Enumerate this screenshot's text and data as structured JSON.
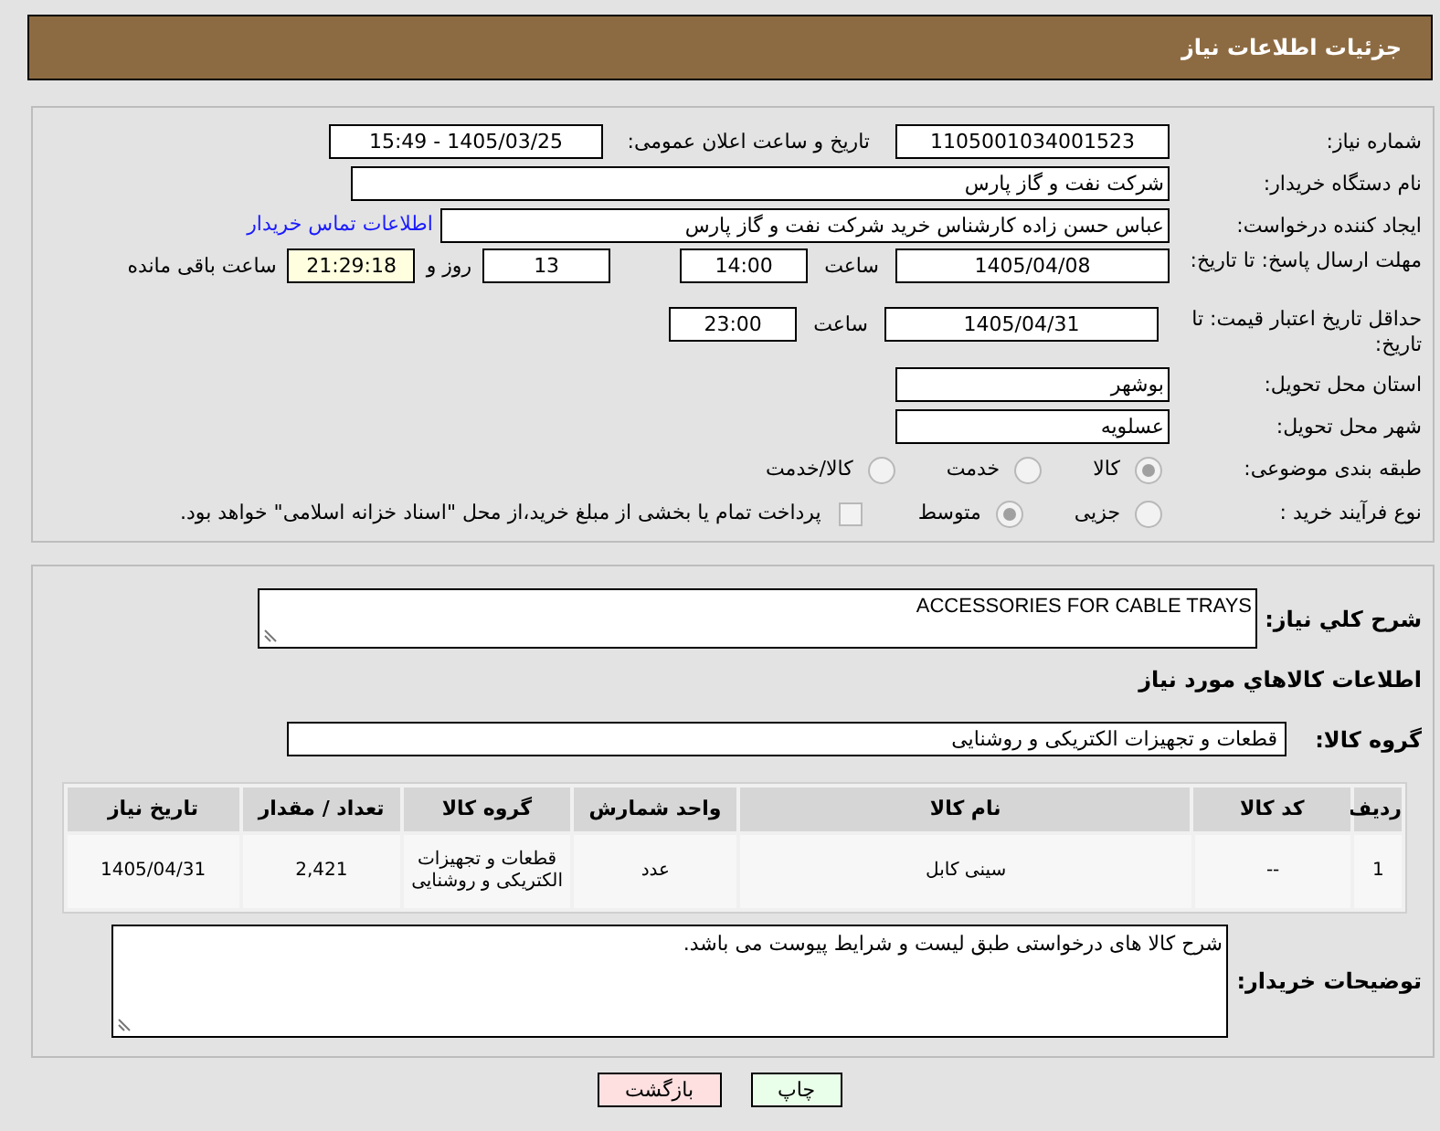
{
  "header": {
    "title": "جزئیات اطلاعات نیاز"
  },
  "details": {
    "need_number": {
      "label": "شماره نیاز:",
      "value": "1105001034001523"
    },
    "announce": {
      "label": "تاریخ و ساعت اعلان عمومی:",
      "value": "1405/03/25 - 15:49"
    },
    "buyer_org": {
      "label": "نام دستگاه خریدار:",
      "value": "شرکت نفت و گاز پارس"
    },
    "requester": {
      "label": "ایجاد کننده درخواست:",
      "value": "عباس حسن زاده کارشناس خرید شرکت نفت و گاز پارس",
      "link": "اطلاعات تماس خریدار"
    },
    "reply_deadline": {
      "label": "مهلت ارسال پاسخ: تا تاریخ:",
      "date": "1405/04/08",
      "time_label": "ساعت",
      "time": "14:00",
      "days": "13",
      "days_label": "روز و",
      "remaining": "21:29:18",
      "remaining_label": "ساعت باقی مانده"
    },
    "price_validity": {
      "label": "حداقل تاریخ اعتبار قیمت: تا تاریخ:",
      "date": "1405/04/31",
      "time_label": "ساعت",
      "time": "23:00"
    },
    "province": {
      "label": "استان محل تحویل:",
      "value": "بوشهر"
    },
    "city": {
      "label": "شهر محل تحویل:",
      "value": "عسلویه"
    },
    "category": {
      "label": "طبقه بندی موضوعی:",
      "options": [
        {
          "label": "کالا",
          "selected": true
        },
        {
          "label": "خدمت",
          "selected": false
        },
        {
          "label": "کالا/خدمت",
          "selected": false
        }
      ]
    },
    "process": {
      "label": "نوع فرآیند خرید :",
      "options": [
        {
          "label": "جزیی",
          "selected": false
        },
        {
          "label": "متوسط",
          "selected": true
        }
      ],
      "payment": {
        "checked": false,
        "text": "پرداخت تمام یا بخشی از مبلغ خرید،از محل \"اسناد خزانه اسلامی\" خواهد بود."
      }
    }
  },
  "summary": {
    "label": "شرح کلي نیاز:",
    "value": "ACCESSORIES FOR CABLE TRAYS"
  },
  "goods": {
    "title": "اطلاعات کالاهاي مورد نیاز",
    "group_label": "گروه کالا:",
    "group": "قطعات و تجهیزات الکتریکی و روشنایی",
    "table": {
      "columns": [
        "ردیف",
        "کد کالا",
        "نام کالا",
        "واحد شمارش",
        "گروه کالا",
        "تعداد / مقدار",
        "تاریخ نیاز"
      ],
      "rows": [
        [
          "1",
          "--",
          "سینی کابل",
          "عدد",
          "قطعات و تجهیزات الکتریکی و روشنایی",
          "2,421",
          "1405/04/31"
        ]
      ]
    }
  },
  "notes": {
    "label": "توضیحات خریدار:",
    "value": "شرح کالا های درخواستی طبق لیست و شرایط پیوست می باشد."
  },
  "buttons": [
    {
      "label": "چاپ",
      "kind": "print"
    },
    {
      "label": "بازگشت",
      "kind": "back"
    }
  ]
}
